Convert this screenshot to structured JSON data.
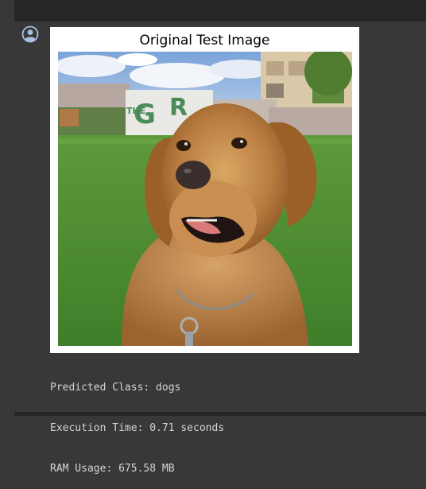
{
  "figure": {
    "title": "Original Test Image",
    "image_subject": "golden retriever dog sitting on grass"
  },
  "output": {
    "lines": [
      "Predicted Class: dogs",
      "Execution Time: 0.71 seconds",
      "RAM Usage: 675.58 MB"
    ]
  },
  "icons": {
    "output_prompt": "user-circle-icon"
  },
  "colors": {
    "background": "#383838",
    "bar": "#262626",
    "text": "#d4d4d4",
    "icon": "#a8c0e0"
  }
}
